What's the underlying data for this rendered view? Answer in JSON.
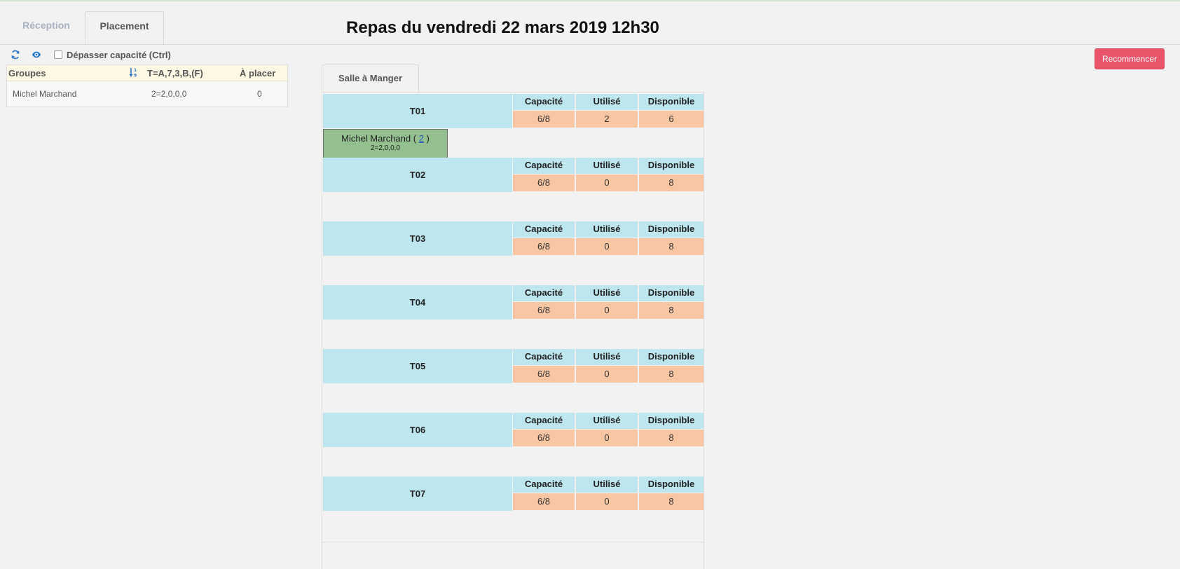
{
  "tabs": [
    {
      "label": "Réception",
      "active": false
    },
    {
      "label": "Placement",
      "active": true
    }
  ],
  "title": "Repas du vendredi 22 mars 2019 12h30",
  "toolbar": {
    "refresh_icon": "refresh-icon",
    "eye_icon": "eye-icon",
    "overflow_checkbox_label": "Dépasser capacité (Ctrl)",
    "overflow_checked": false
  },
  "restart_button": "Recommencer",
  "groups": {
    "headers": {
      "name": "Groupes",
      "types": "T=A,7,3,B,(F)",
      "to_place": "À placer"
    },
    "sort_icon": "sort-numeric-icon",
    "rows": [
      {
        "name": "Michel Marchand",
        "types": "2=2,0,0,0",
        "to_place": "0"
      }
    ]
  },
  "room": {
    "label": "Salle à Manger"
  },
  "table_headers": {
    "capacity": "Capacité",
    "used": "Utilisé",
    "available": "Disponible"
  },
  "tables": [
    {
      "name": "T01",
      "capacity": "6/8",
      "used": "2",
      "available": "6",
      "guests": [
        {
          "name": "Michel Marchand",
          "count": "2",
          "detail": "2=2,0,0,0"
        }
      ]
    },
    {
      "name": "T02",
      "capacity": "6/8",
      "used": "0",
      "available": "8",
      "guests": []
    },
    {
      "name": "T03",
      "capacity": "6/8",
      "used": "0",
      "available": "8",
      "guests": []
    },
    {
      "name": "T04",
      "capacity": "6/8",
      "used": "0",
      "available": "8",
      "guests": []
    },
    {
      "name": "T05",
      "capacity": "6/8",
      "used": "0",
      "available": "8",
      "guests": []
    },
    {
      "name": "T06",
      "capacity": "6/8",
      "used": "0",
      "available": "8",
      "guests": []
    },
    {
      "name": "T07",
      "capacity": "6/8",
      "used": "0",
      "available": "8",
      "guests": []
    }
  ],
  "colors": {
    "table_header": "#bde6ef",
    "table_values": "#f9c6a3",
    "guest_card": "#93c08e",
    "restart_button": "#e9546b",
    "groups_header": "#fcf8e3"
  }
}
